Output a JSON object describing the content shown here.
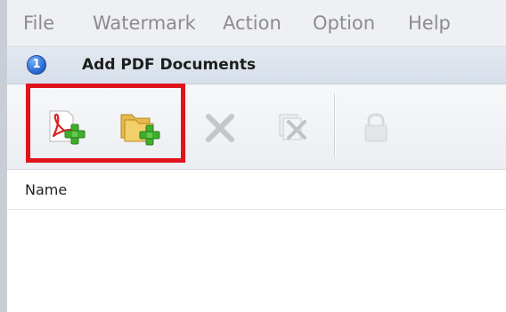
{
  "menu": {
    "file": "File",
    "watermark": "Watermark",
    "action": "Action",
    "option": "Option",
    "help": "Help"
  },
  "section": {
    "step": "1",
    "title": "Add PDF Documents"
  },
  "toolbar": {
    "buttons": [
      {
        "icon": "pdf-add-icon",
        "state": "enabled"
      },
      {
        "icon": "folder-add-icon",
        "state": "enabled"
      },
      {
        "icon": "remove-x-icon",
        "state": "disabled"
      },
      {
        "icon": "remove-all-icon",
        "state": "disabled"
      },
      {
        "icon": "lock-icon",
        "state": "disabled"
      }
    ]
  },
  "list": {
    "columns": [
      "Name"
    ]
  },
  "colors": {
    "highlight": "#e0141c",
    "badge": "#1f5fc9",
    "menu_text": "#8c8c8c",
    "add_green": "#3fae2a"
  }
}
